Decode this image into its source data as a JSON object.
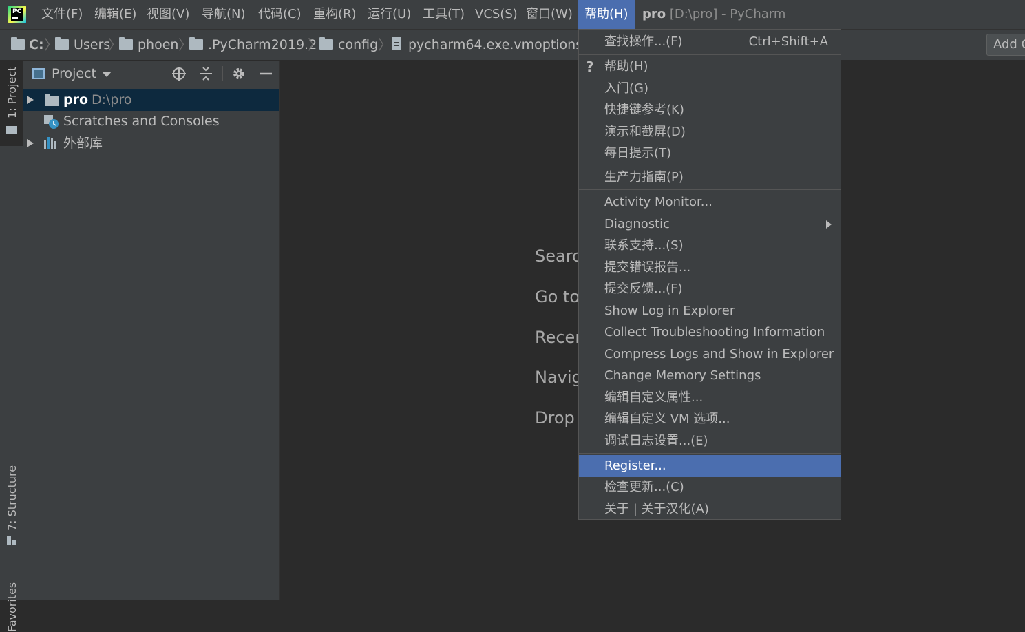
{
  "menubar": {
    "items": [
      "文件(F)",
      "编辑(E)",
      "视图(V)",
      "导航(N)",
      "代码(C)",
      "重构(R)",
      "运行(U)",
      "工具(T)",
      "VCS(S)",
      "窗口(W)",
      "帮助(H)"
    ],
    "active_item": "帮助(H)",
    "title_project": "pro",
    "title_rest": " [D:\\pro] - PyCharm"
  },
  "breadcrumb": {
    "items": [
      "C:",
      "Users",
      "phoen",
      ".PyCharm2019.2",
      "config",
      "pycharm64.exe.vmoptions"
    ],
    "add_config_label": "Add C"
  },
  "left_strip": {
    "project_tab": "1: Project",
    "structure_tab": "7: Structure",
    "favorites_tab": "Favorites"
  },
  "project_panel": {
    "title": "Project",
    "tree": [
      {
        "name": "pro",
        "path": "D:\\pro"
      },
      {
        "name": "Scratches and Consoles"
      },
      {
        "name": "外部库"
      }
    ]
  },
  "editor_hints": [
    "Searc",
    "Go to",
    "Recer",
    "Navig",
    "Drop"
  ],
  "help_menu": {
    "find_action": {
      "label": "查找操作...(F)",
      "shortcut": "Ctrl+Shift+A"
    },
    "group1": [
      "帮助(H)",
      "入门(G)",
      "快捷键参考(K)",
      "演示和截屏(D)",
      "每日提示(T)"
    ],
    "group2": [
      "生产力指南(P)"
    ],
    "group3": [
      "Activity Monitor...",
      "Diagnostic",
      "联系支持...(S)",
      "提交错误报告...",
      "提交反馈...(F)",
      "Show Log in Explorer",
      "Collect Troubleshooting Information",
      "Compress Logs and Show in Explorer",
      "Change Memory Settings",
      "编辑自定义属性...",
      "编辑自定义 VM 选项...",
      "调试日志设置...(E)"
    ],
    "group4": [
      "Register...",
      "检查更新...(C)",
      "关于 | 关于汉化(A)"
    ],
    "highlighted": "Register...",
    "highlight_color": "#4b6eaf"
  }
}
